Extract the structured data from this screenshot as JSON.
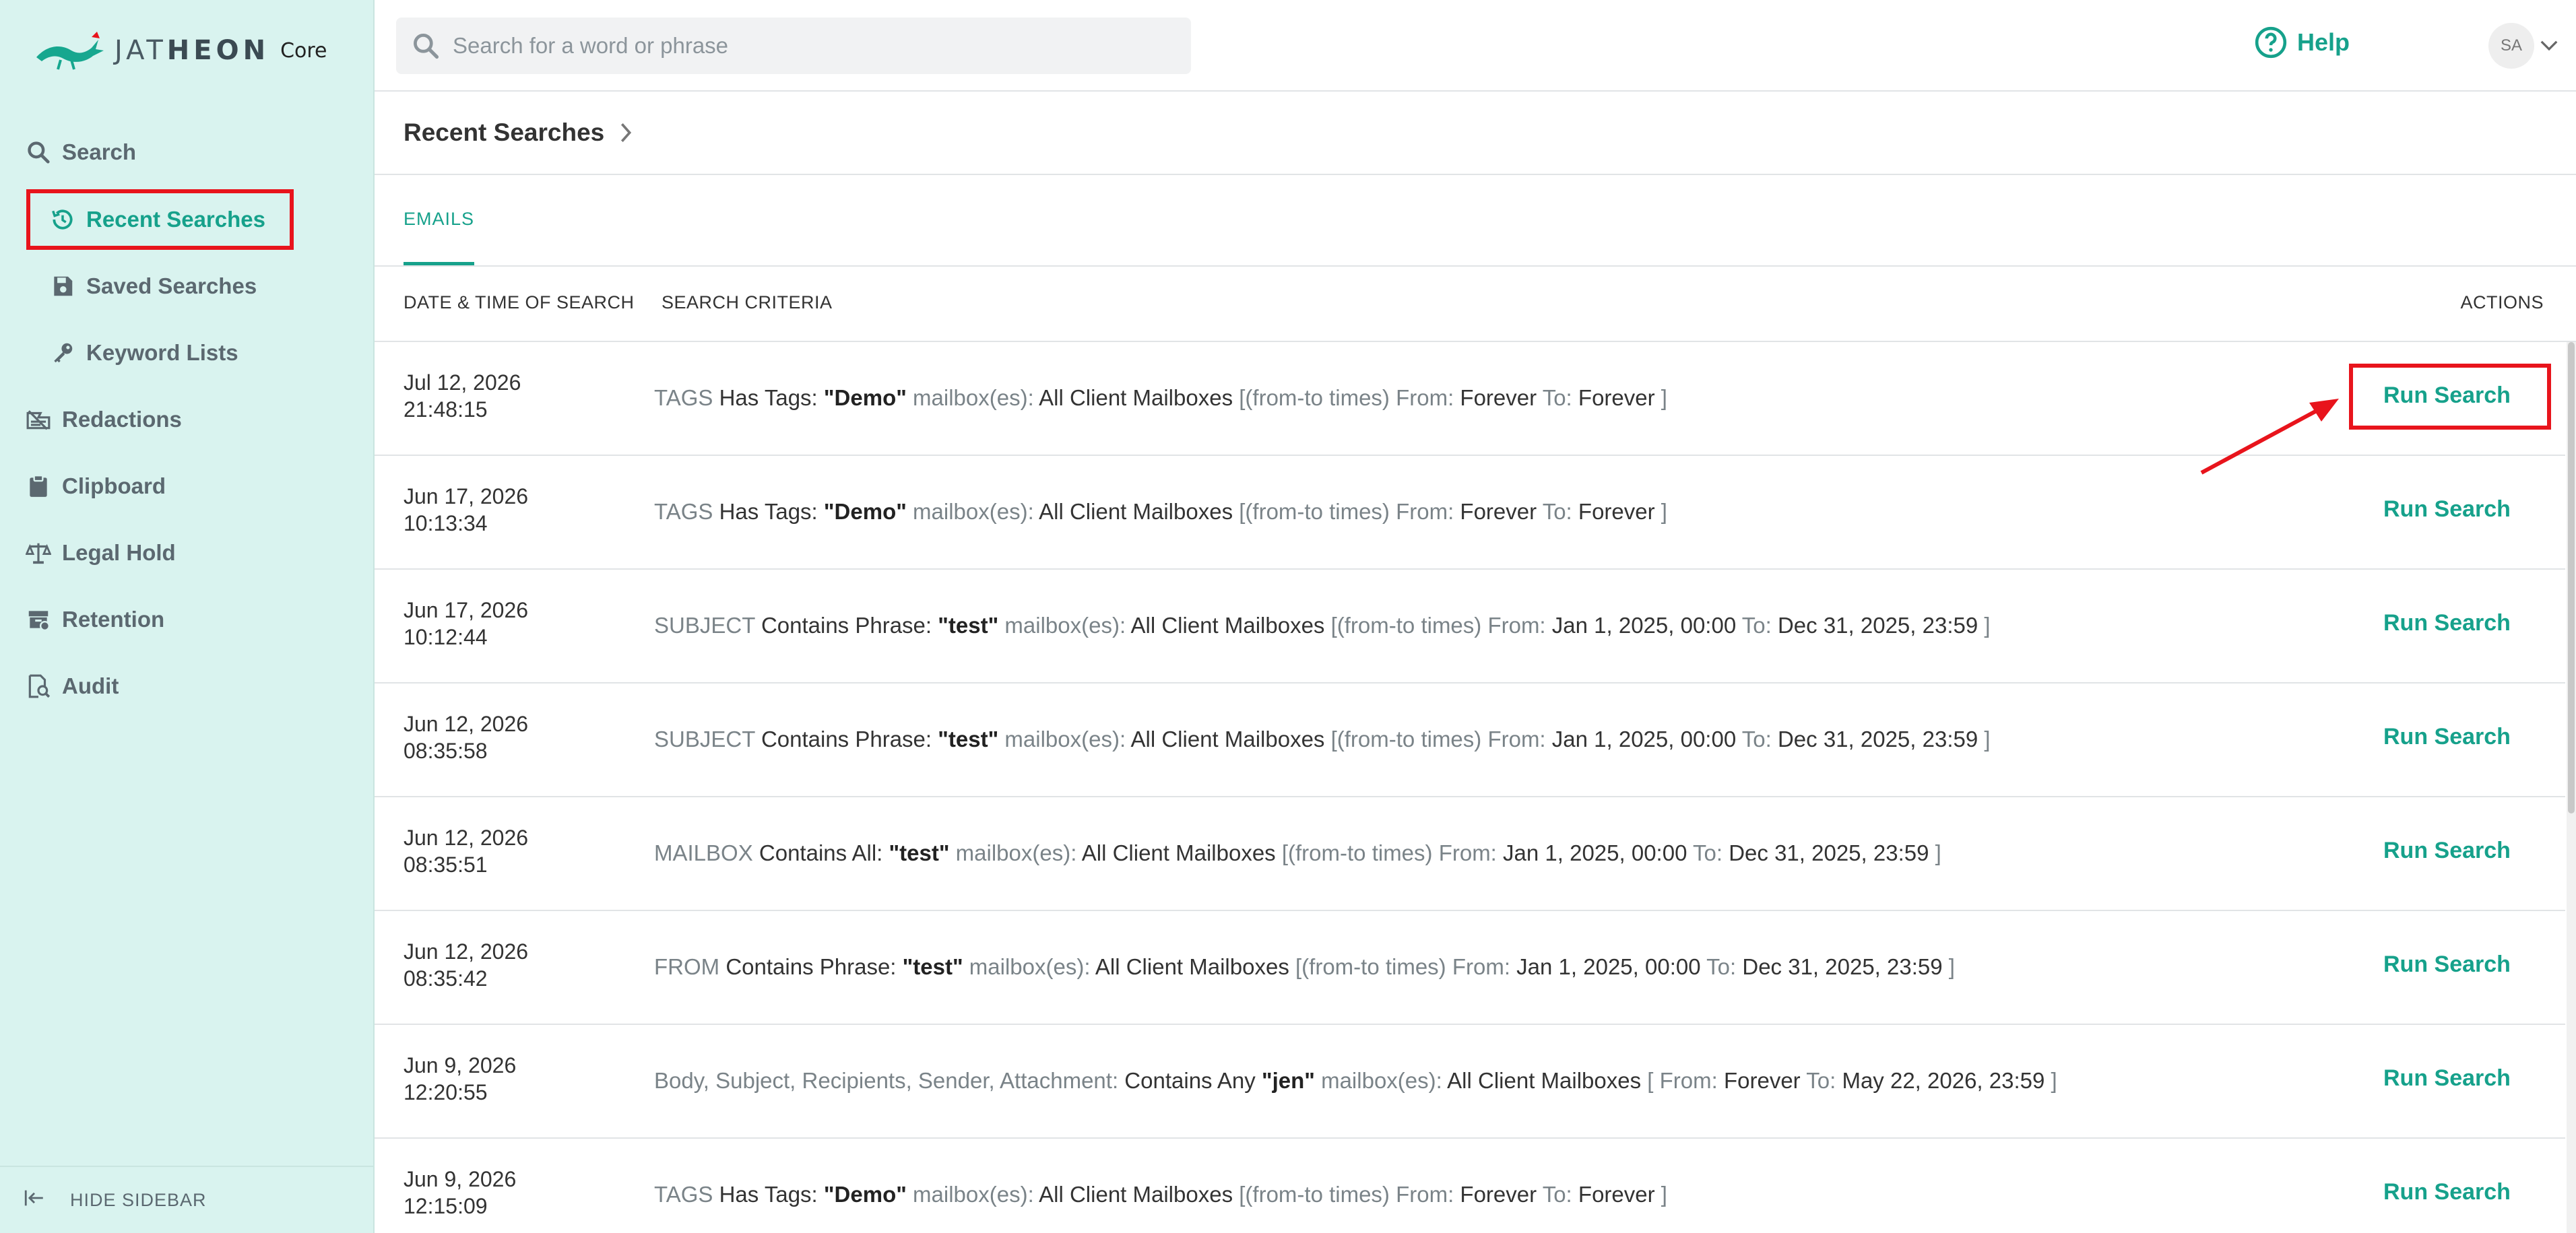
{
  "brand": {
    "name_light": "JAT",
    "name_bold": "HEON",
    "product": "Core"
  },
  "sidebar": {
    "items": [
      {
        "label": "Search"
      },
      {
        "label": "Recent Searches"
      },
      {
        "label": "Saved Searches"
      },
      {
        "label": "Keyword Lists"
      },
      {
        "label": "Redactions"
      },
      {
        "label": "Clipboard"
      },
      {
        "label": "Legal Hold"
      },
      {
        "label": "Retention"
      },
      {
        "label": "Audit"
      }
    ],
    "hide_label": "HIDE SIDEBAR"
  },
  "topbar": {
    "search_placeholder": "Search for a word or phrase",
    "help_label": "Help",
    "avatar_initials": "SA"
  },
  "page": {
    "title": "Recent Searches"
  },
  "tabs": [
    {
      "label": "EMAILS"
    }
  ],
  "columns": {
    "date": "DATE & TIME OF SEARCH",
    "criteria": "SEARCH CRITERIA",
    "actions": "ACTIONS"
  },
  "rows": [
    {
      "date": "Jul 12, 2026",
      "time": "21:48:15",
      "field": "TAGS",
      "op": "Has Tags:",
      "term": "\"Demo\"",
      "mb_label": "mailbox(es):",
      "mailbox": "All Client Mailboxes",
      "range_open": "[(from-to times) From:",
      "from": "Forever",
      "to_label": "To:",
      "to": "Forever",
      "range_close": "]",
      "action": "Run Search"
    },
    {
      "date": "Jun 17, 2026",
      "time": "10:13:34",
      "field": "TAGS",
      "op": "Has Tags:",
      "term": "\"Demo\"",
      "mb_label": "mailbox(es):",
      "mailbox": "All Client Mailboxes",
      "range_open": "[(from-to times) From:",
      "from": "Forever",
      "to_label": "To:",
      "to": "Forever",
      "range_close": "]",
      "action": "Run Search"
    },
    {
      "date": "Jun 17, 2026",
      "time": "10:12:44",
      "field": "SUBJECT",
      "op": "Contains Phrase:",
      "term": "\"test\"",
      "mb_label": "mailbox(es):",
      "mailbox": "All Client Mailboxes",
      "range_open": "[(from-to times) From:",
      "from": "Jan 1, 2025, 00:00",
      "to_label": "To:",
      "to": "Dec 31, 2025, 23:59",
      "range_close": "]",
      "action": "Run Search"
    },
    {
      "date": "Jun 12, 2026",
      "time": "08:35:58",
      "field": "SUBJECT",
      "op": "Contains Phrase:",
      "term": "\"test\"",
      "mb_label": "mailbox(es):",
      "mailbox": "All Client Mailboxes",
      "range_open": "[(from-to times) From:",
      "from": "Jan 1, 2025, 00:00",
      "to_label": "To:",
      "to": "Dec 31, 2025, 23:59",
      "range_close": "]",
      "action": "Run Search"
    },
    {
      "date": "Jun 12, 2026",
      "time": "08:35:51",
      "field": "MAILBOX",
      "op": "Contains All:",
      "term": "\"test\"",
      "mb_label": "mailbox(es):",
      "mailbox": "All Client Mailboxes",
      "range_open": "[(from-to times) From:",
      "from": "Jan 1, 2025, 00:00",
      "to_label": "To:",
      "to": "Dec 31, 2025, 23:59",
      "range_close": "]",
      "action": "Run Search"
    },
    {
      "date": "Jun 12, 2026",
      "time": "08:35:42",
      "field": "FROM",
      "op": "Contains Phrase:",
      "term": "\"test\"",
      "mb_label": "mailbox(es):",
      "mailbox": "All Client Mailboxes",
      "range_open": "[(from-to times) From:",
      "from": "Jan 1, 2025, 00:00",
      "to_label": "To:",
      "to": "Dec 31, 2025, 23:59",
      "range_close": "]",
      "action": "Run Search"
    },
    {
      "date": "Jun 9, 2026",
      "time": "12:20:55",
      "field": "Body, Subject, Recipients, Sender, Attachment:",
      "op": "Contains Any",
      "term": "\"jen\"",
      "mb_label": "mailbox(es):",
      "mailbox": "All Client Mailboxes",
      "range_open": "[ From:",
      "from": "Forever",
      "to_label": "To:",
      "to": "May 22, 2026, 23:59",
      "range_close": "]",
      "action": "Run Search"
    },
    {
      "date": "Jun 9, 2026",
      "time": "12:15:09",
      "field": "TAGS",
      "op": "Has Tags:",
      "term": "\"Demo\"",
      "mb_label": "mailbox(es):",
      "mailbox": "All Client Mailboxes",
      "range_open": "[(from-to times) From:",
      "from": "Forever",
      "to_label": "To:",
      "to": "Forever",
      "range_close": "]",
      "action": "Run Search"
    }
  ],
  "colors": {
    "accent": "#16a18b",
    "sidebar_bg": "#d9f3ef",
    "highlight": "#e8141c"
  }
}
